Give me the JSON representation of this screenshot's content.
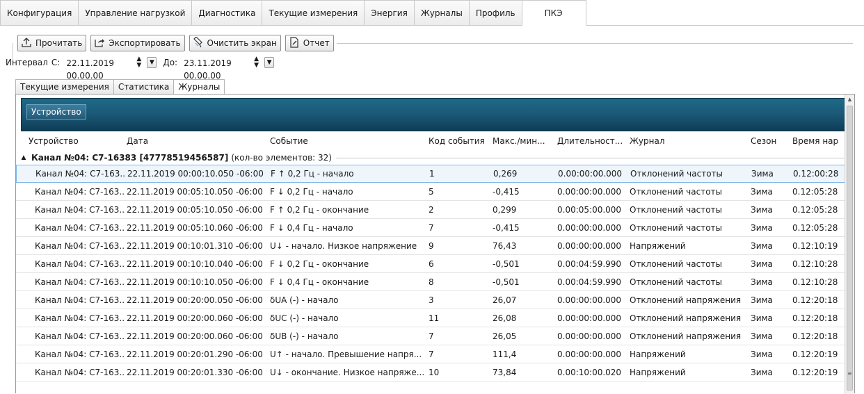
{
  "top_tabs": [
    "Конфигурация",
    "Управление нагрузкой",
    "Диагностика",
    "Текущие измерения",
    "Энергия",
    "Журналы",
    "Профиль",
    "ПКЭ"
  ],
  "toolbar": {
    "read_label": "Прочитать",
    "export_label": "Экспортировать",
    "clear_label": "Очистить экран",
    "report_label": "Отчет"
  },
  "interval": {
    "label": "Интервал",
    "from_label": "С:",
    "from_value": "22.11.2019 00.00.00",
    "to_label": "До:",
    "to_value": "23.11.2019 00.00.00"
  },
  "sub_tabs": [
    "Текущие измерения",
    "Статистика",
    "Журналы"
  ],
  "grid": {
    "group_button": "Устройство",
    "columns": [
      "Устройство",
      "Дата",
      "Событие",
      "Код события",
      "Макс./мин...",
      "Длительност...",
      "Журнал",
      "Сезон",
      "Время нар"
    ],
    "group_title": "Канал №04: С7-16383 [47778519456587]",
    "group_count": "(кол-во элементов: 32)",
    "rows": [
      [
        "Канал №04: С7-163...",
        "22.11.2019 00:00:10.050 -06:00",
        "F ↑ 0,2 Гц - начало",
        "1",
        "0,269",
        "0.00:00:00.000",
        "Отклонений частоты",
        "Зима",
        "0.12:00:28"
      ],
      [
        "Канал №04: С7-163...",
        "22.11.2019 00:05:10.050 -06:00",
        "F ↓ 0,2 Гц - начало",
        "5",
        "-0,415",
        "0.00:00:00.000",
        "Отклонений частоты",
        "Зима",
        "0.12:05:28"
      ],
      [
        "Канал №04: С7-163...",
        "22.11.2019 00:05:10.050 -06:00",
        "F ↑ 0,2 Гц - окончание",
        "2",
        "0,299",
        "0.00:05:00.000",
        "Отклонений частоты",
        "Зима",
        "0.12:05:28"
      ],
      [
        "Канал №04: С7-163...",
        "22.11.2019 00:05:10.060 -06:00",
        "F ↓ 0,4 Гц - начало",
        "7",
        "-0,415",
        "0.00:00:00.000",
        "Отклонений частоты",
        "Зима",
        "0.12:05:28"
      ],
      [
        "Канал №04: С7-163...",
        "22.11.2019 00:10:01.310 -06:00",
        "U↓ - начало. Низкое напряжение",
        "9",
        "76,43",
        "0.00:00:00.000",
        "Напряжений",
        "Зима",
        "0.12:10:19"
      ],
      [
        "Канал №04: С7-163...",
        "22.11.2019 00:10:10.040 -06:00",
        "F ↓ 0,2 Гц - окончание",
        "6",
        "-0,501",
        "0.00:04:59.990",
        "Отклонений частоты",
        "Зима",
        "0.12:10:28"
      ],
      [
        "Канал №04: С7-163...",
        "22.11.2019 00:10:10.050 -06:00",
        "F ↓ 0,4 Гц - окончание",
        "8",
        "-0,501",
        "0.00:04:59.990",
        "Отклонений частоты",
        "Зима",
        "0.12:10:28"
      ],
      [
        "Канал №04: С7-163...",
        "22.11.2019 00:20:00.050 -06:00",
        "δUA (-) - начало",
        "3",
        "26,07",
        "0.00:00:00.000",
        "Отклонений напряжения",
        "Зима",
        "0.12:20:18"
      ],
      [
        "Канал №04: С7-163...",
        "22.11.2019 00:20:00.060 -06:00",
        "δUC (-) - начало",
        "11",
        "26,08",
        "0.00:00:00.000",
        "Отклонений напряжения",
        "Зима",
        "0.12:20:18"
      ],
      [
        "Канал №04: С7-163...",
        "22.11.2019 00:20:00.060 -06:00",
        "δUB (-) - начало",
        "7",
        "26,05",
        "0.00:00:00.000",
        "Отклонений напряжения",
        "Зима",
        "0.12:20:18"
      ],
      [
        "Канал №04: С7-163...",
        "22.11.2019 00:20:01.290 -06:00",
        "U↑ - начало. Превышение напря...",
        "7",
        "111,4",
        "0.00:00:00.000",
        "Напряжений",
        "Зима",
        "0.12:20:19"
      ],
      [
        "Канал №04: С7-163...",
        "22.11.2019 00:20:01.330 -06:00",
        "U↓ - окончание. Низкое напряже...",
        "10",
        "73,84",
        "0.00:10:00.020",
        "Напряжений",
        "Зима",
        "0.12:20:19"
      ]
    ]
  },
  "colors": {
    "header_band": "#1c5a78",
    "selection_border": "#7eb4ea"
  }
}
